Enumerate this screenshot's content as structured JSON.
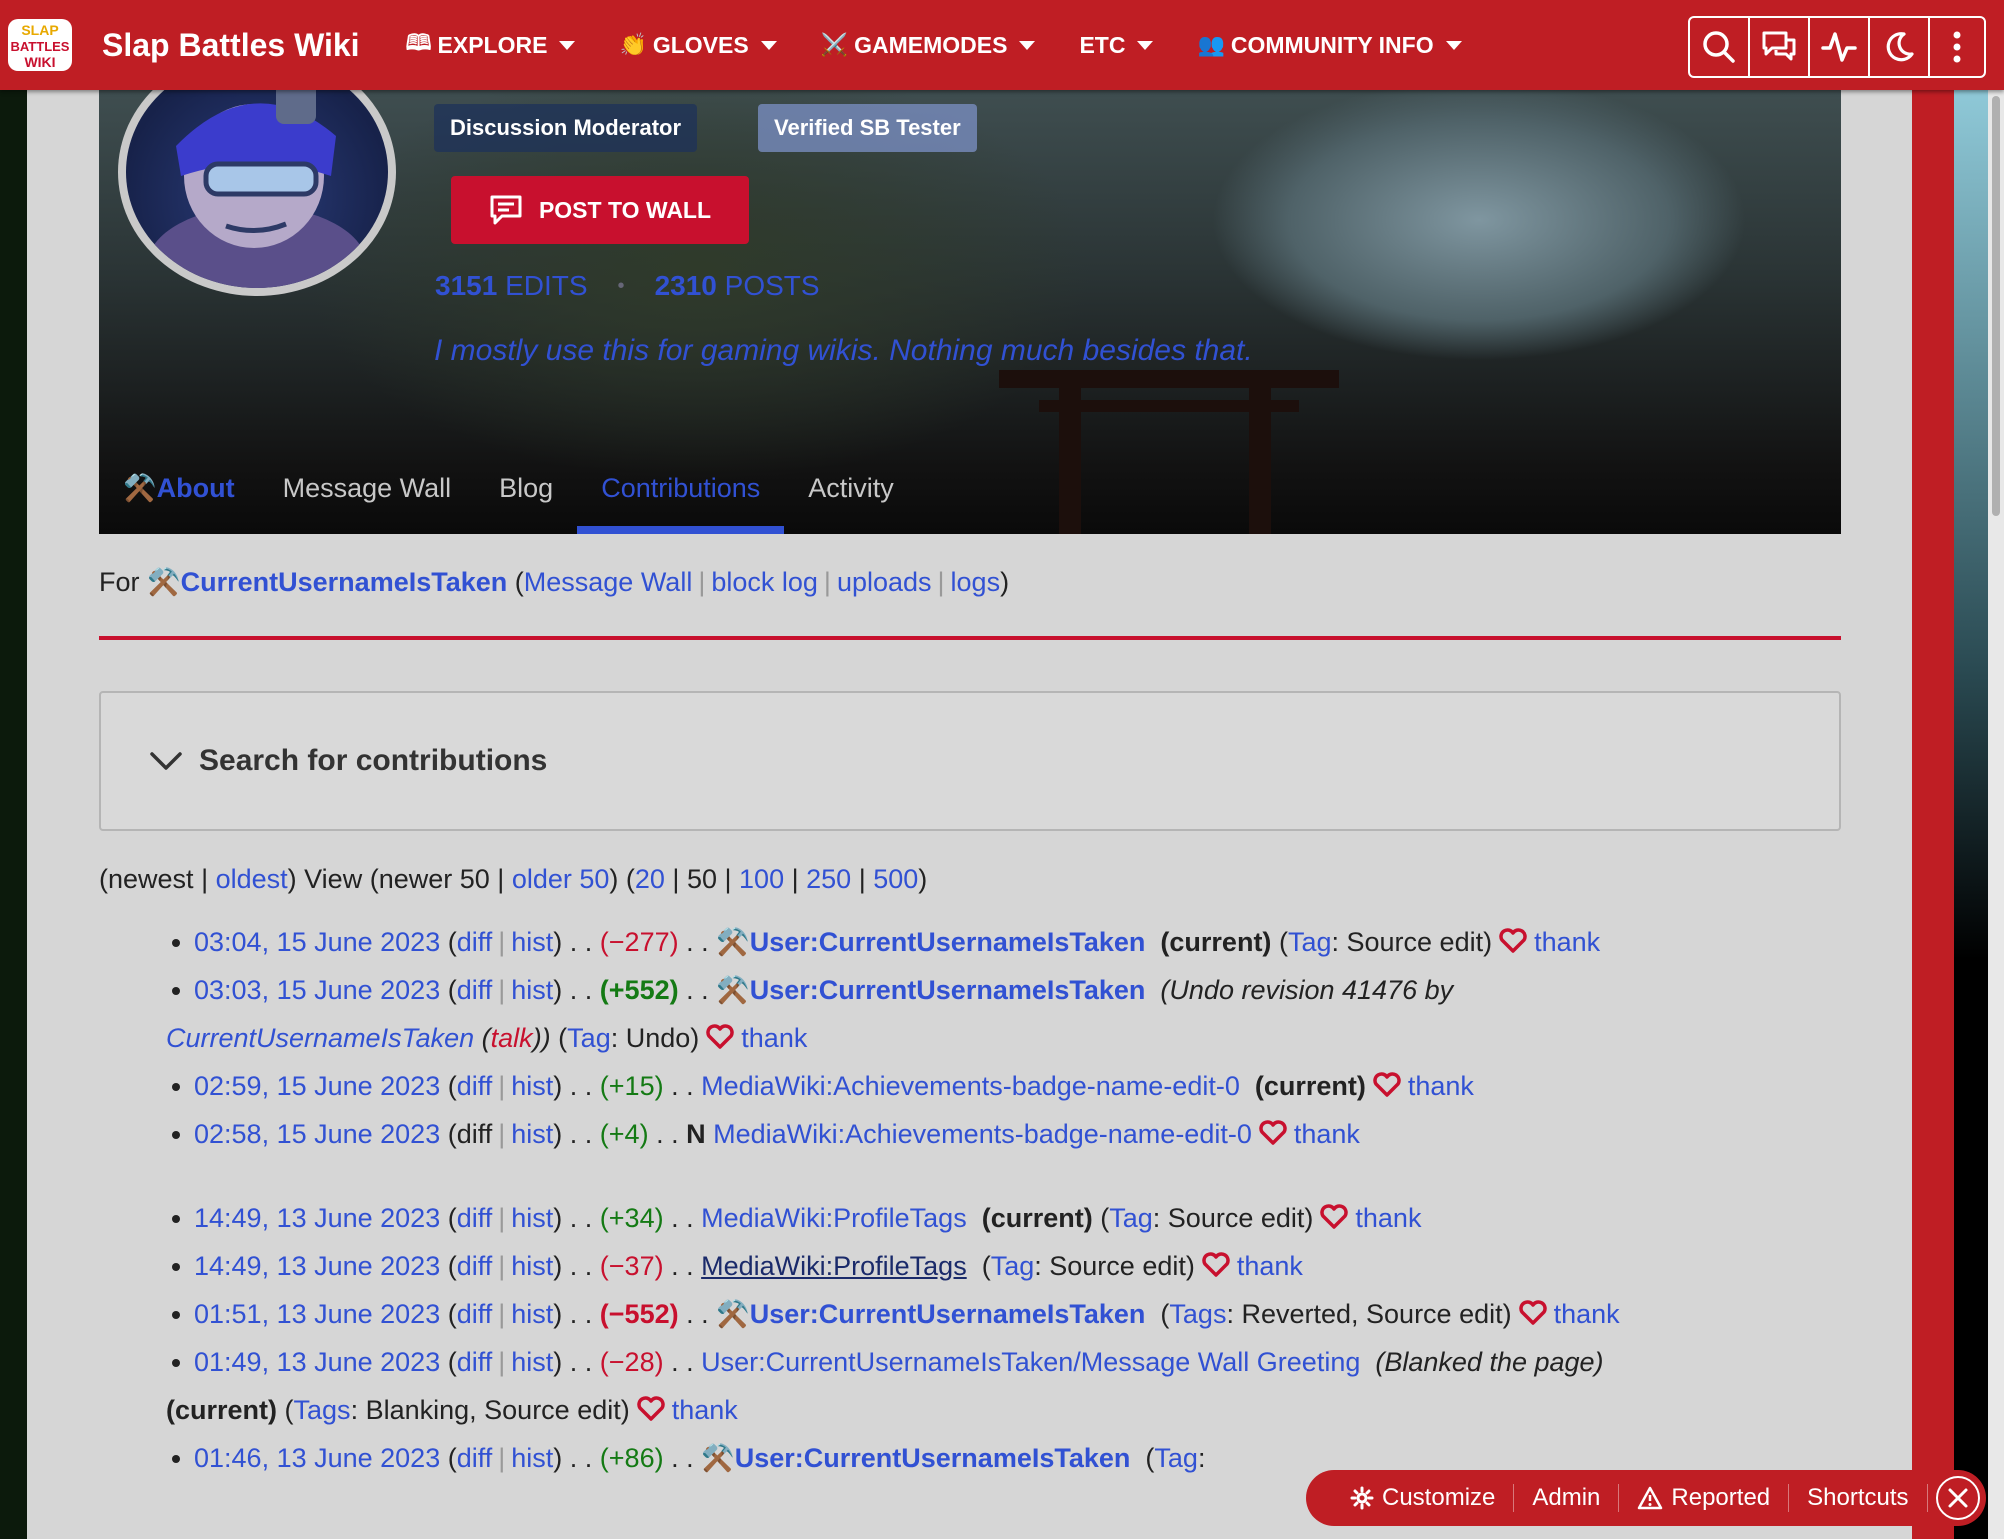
{
  "site": {
    "name": "Slap Battles Wiki",
    "nav": [
      {
        "emoji": "🕮",
        "label": "EXPLORE"
      },
      {
        "emoji": "👏",
        "label": "GLOVES"
      },
      {
        "emoji": "⚔️",
        "label": "GAMEMODES"
      },
      {
        "emoji": "",
        "label": "ETC"
      },
      {
        "emoji": "👥",
        "label": "COMMUNITY INFO"
      }
    ],
    "logo_text": [
      "SLAP",
      "BATTLES",
      "WIKI"
    ]
  },
  "profile": {
    "badges": [
      "Discussion Moderator",
      "Verified SB Tester"
    ],
    "post_to_wall": "POST TO WALL",
    "edits_count": "3151",
    "edits_label": "EDITS",
    "posts_count": "2310",
    "posts_label": "POSTS",
    "bio": "I mostly use this for gaming wikis. Nothing much besides that.",
    "tabs": [
      "About",
      "Message Wall",
      "Blog",
      "Contributions",
      "Activity"
    ]
  },
  "for_line": {
    "prefix": "For",
    "username": "CurrentUsernameIsTaken",
    "links": [
      "Message Wall",
      "block log",
      "uploads",
      "logs"
    ]
  },
  "search": {
    "title": "Search for contributions"
  },
  "pager": {
    "newest": "newest",
    "oldest": "oldest",
    "view": "View",
    "newer": "newer 50",
    "older": "older 50",
    "limits": [
      "20",
      "50",
      "100",
      "250",
      "500"
    ]
  },
  "contributions": [
    {
      "time": "03:04, 15 June 2023",
      "diff": "diff",
      "hist": "hist",
      "delta": "(−277)",
      "page": "User:CurrentUsernameIsTaken",
      "flag": "(current)",
      "tag_label": "Tag",
      "tags": "Source edit",
      "thank": "thank"
    },
    {
      "time": "03:03, 15 June 2023",
      "diff": "diff",
      "hist": "hist",
      "delta": "(+552)",
      "page": "User:CurrentUsernameIsTaken",
      "summary": "(Undo revision 41476 by",
      "summary_user": "CurrentUsernameIsTaken",
      "summary_talk": "talk",
      "tag_label": "Tag",
      "tags": "Undo",
      "thank": "thank"
    },
    {
      "time": "02:59, 15 June 2023",
      "diff": "diff",
      "hist": "hist",
      "delta": "(+15)",
      "page": "MediaWiki:Achievements-badge-name-edit-0",
      "flag": "(current)",
      "thank": "thank"
    },
    {
      "time": "02:58, 15 June 2023",
      "diff": "diff",
      "hist": "hist",
      "delta": "(+4)",
      "new": "N",
      "page": "MediaWiki:Achievements-badge-name-edit-0",
      "thank": "thank"
    },
    {
      "time": "14:49, 13 June 2023",
      "diff": "diff",
      "hist": "hist",
      "delta": "(+34)",
      "page": "MediaWiki:ProfileTags",
      "flag": "(current)",
      "tag_label": "Tag",
      "tags": "Source edit",
      "thank": "thank"
    },
    {
      "time": "14:49, 13 June 2023",
      "diff": "diff",
      "hist": "hist",
      "delta": "(−37)",
      "page": "MediaWiki:ProfileTags",
      "tag_label": "Tag",
      "tags": "Source edit",
      "thank": "thank"
    },
    {
      "time": "01:51, 13 June 2023",
      "diff": "diff",
      "hist": "hist",
      "delta": "(−552)",
      "page": "User:CurrentUsernameIsTaken",
      "tag_label": "Tags",
      "tags": "Reverted, Source edit",
      "thank": "thank"
    },
    {
      "time": "01:49, 13 June 2023",
      "diff": "diff",
      "hist": "hist",
      "delta": "(−28)",
      "page": "User:CurrentUsernameIsTaken/Message Wall Greeting",
      "summary": "(Blanked the page)",
      "flag": "(current)",
      "tag_label": "Tags",
      "tags": "Blanking, Source edit",
      "thank": "thank"
    },
    {
      "time": "01:46, 13 June 2023",
      "diff": "diff",
      "hist": "hist",
      "delta": "(+86)",
      "page": "User:CurrentUsernameIsTaken",
      "tag_label": "Tag"
    }
  ],
  "toolbar": {
    "customize": "Customize",
    "admin": "Admin",
    "reported": "Reported",
    "shortcuts": "Shortcuts"
  },
  "colors": {
    "brand_red": "#bf1e24",
    "link_blue": "#3151d3",
    "negative": "#c8102e",
    "positive": "#147a14"
  }
}
